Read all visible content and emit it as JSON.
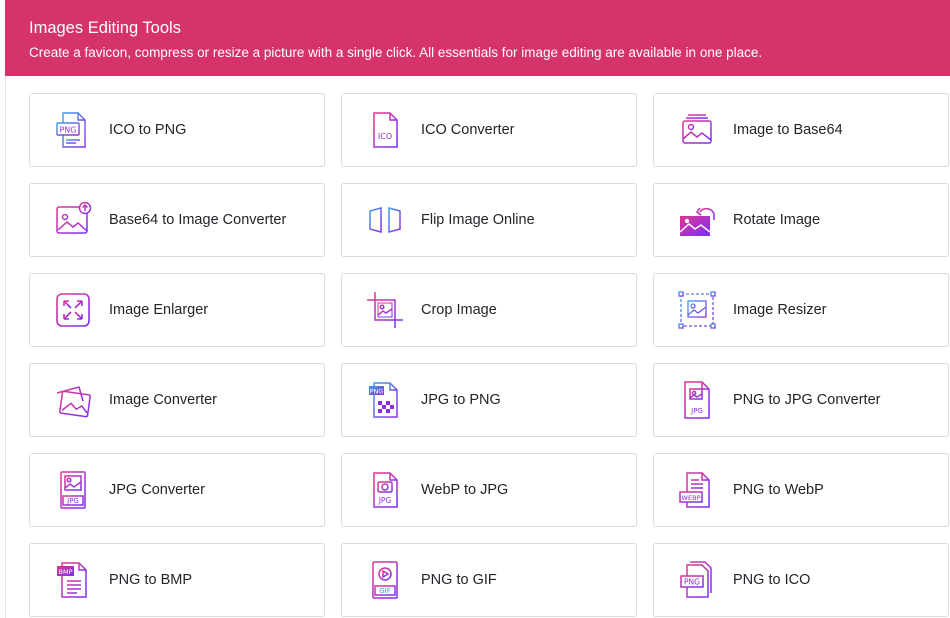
{
  "header": {
    "title": "Images Editing Tools",
    "subtitle": "Create a favicon, compress or resize a picture with a single click. All essentials for image editing are available in one place."
  },
  "colors": {
    "header_bg": "#d6336c",
    "icon_purple": "#8e2de2",
    "icon_pink": "#e0368f",
    "icon_blue": "#3aa0e6"
  },
  "tools": [
    {
      "label": "ICO to PNG",
      "icon": "png-file-icon",
      "name": "ico-to-png"
    },
    {
      "label": "ICO Converter",
      "icon": "ico-file-icon",
      "name": "ico-converter"
    },
    {
      "label": "Image to Base64",
      "icon": "image-stack-icon",
      "name": "image-to-base64"
    },
    {
      "label": "Base64 to Image Converter",
      "icon": "image-upload-icon",
      "name": "base64-to-image-converter"
    },
    {
      "label": "Flip Image Online",
      "icon": "flip-icon",
      "name": "flip-image-online"
    },
    {
      "label": "Rotate Image",
      "icon": "rotate-image-icon",
      "name": "rotate-image"
    },
    {
      "label": "Image Enlarger",
      "icon": "expand-arrows-icon",
      "name": "image-enlarger"
    },
    {
      "label": "Crop Image",
      "icon": "crop-icon",
      "name": "crop-image"
    },
    {
      "label": "Image Resizer",
      "icon": "resize-frame-icon",
      "name": "image-resizer"
    },
    {
      "label": "Image Converter",
      "icon": "photo-stack-icon",
      "name": "image-converter"
    },
    {
      "label": "JPG to PNG",
      "icon": "png-checker-file-icon",
      "name": "jpg-to-png"
    },
    {
      "label": "PNG to JPG Converter",
      "icon": "jpg-file-icon",
      "name": "png-to-jpg-converter"
    },
    {
      "label": "JPG Converter",
      "icon": "jpg-image-file-icon",
      "name": "jpg-converter"
    },
    {
      "label": "WebP to JPG",
      "icon": "camera-jpg-file-icon",
      "name": "webp-to-jpg"
    },
    {
      "label": "PNG to WebP",
      "icon": "webp-file-icon",
      "name": "png-to-webp"
    },
    {
      "label": "PNG to BMP",
      "icon": "bmp-file-icon",
      "name": "png-to-bmp"
    },
    {
      "label": "PNG to GIF",
      "icon": "gif-file-icon",
      "name": "png-to-gif"
    },
    {
      "label": "PNG to ICO",
      "icon": "png-stack-icon",
      "name": "png-to-ico"
    }
  ],
  "icon_text": {
    "png": "PNG",
    "ico": "ICO",
    "jpg": "JPG",
    "webp": "WEBP",
    "bmp": "BMP",
    "gif": "GIF"
  }
}
